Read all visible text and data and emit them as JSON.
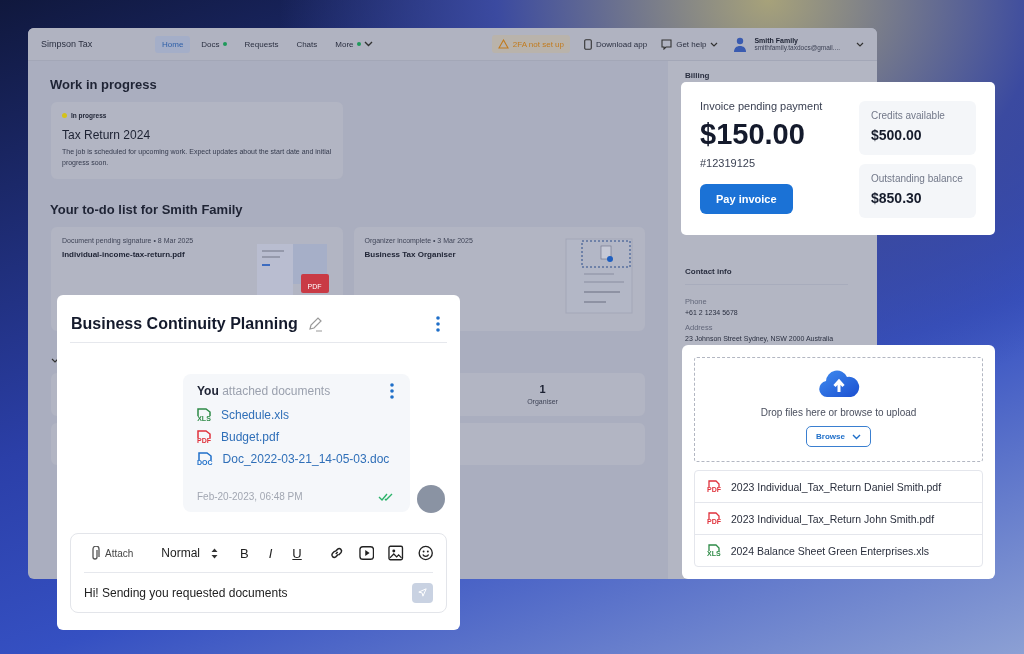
{
  "app": {
    "brand": "Simpson Tax",
    "nav": [
      {
        "label": "Home",
        "selected": true,
        "dot": false,
        "dropdown": false
      },
      {
        "label": "Docs",
        "selected": false,
        "dot": true,
        "dropdown": false
      },
      {
        "label": "Requests",
        "selected": false,
        "dot": false,
        "dropdown": false
      },
      {
        "label": "Chats",
        "selected": false,
        "dot": false,
        "dropdown": false
      },
      {
        "label": "More",
        "selected": false,
        "dot": true,
        "dropdown": true
      }
    ],
    "warning": "2FA not set up",
    "download": "Download app",
    "help": "Get help",
    "user": {
      "name": "Smith Family",
      "email": "smithfamily.taxdocs@gmail...."
    },
    "work_title": "Work in progress",
    "job": {
      "status": "In progress",
      "title": "Tax Return 2024",
      "description": "The job is scheduled for upcoming work. Expect updates about the start date and initial progress soon."
    },
    "todo_title": "Your to-do list for Smith Family",
    "todos": [
      {
        "kind": "pdf",
        "meta": "Document pending signature • 8 Mar 2025",
        "title": "Individual-income-tax-return.pdf",
        "badge": "PDF"
      },
      {
        "kind": "organiser",
        "meta": "Organizer incomplete • 3 Mar 2025",
        "title": "Business Tax Organiser"
      }
    ],
    "stats": [
      {
        "value": "1",
        "label": "Organiser"
      }
    ],
    "sidebar": {
      "billing": "Billing",
      "contact": "Contact info",
      "fields": [
        {
          "label": "Phone",
          "value": "+61 2 1234 5678"
        },
        {
          "label": "Address",
          "value": "23 Johnson Street Sydney, NSW 2000 Australia"
        }
      ]
    }
  },
  "invoice": {
    "label": "Invoice pending payment",
    "amount": "$150.00",
    "number": "#12319125",
    "button": "Pay invoice",
    "boxes": [
      {
        "label": "Credits available",
        "value": "$500.00"
      },
      {
        "label": "Outstanding balance",
        "value": "$850.30"
      }
    ]
  },
  "chat": {
    "title": "Business Continuity Planning",
    "message": {
      "author": "You",
      "action": "attached documents",
      "time": "Feb-20-2023, 06:48 PM",
      "read": true,
      "files": [
        {
          "kind": "xls",
          "badge": "XLS",
          "name": "Schedule.xls"
        },
        {
          "kind": "pdf",
          "badge": "PDF",
          "name": "Budget.pdf"
        },
        {
          "kind": "doc",
          "badge": "DOC",
          "name": "Doc_2022-03-21_14-05-03.doc"
        }
      ]
    },
    "toolbar": {
      "attach": "Attach",
      "style": "Normal",
      "bold": "B",
      "italic": "I",
      "underline": "U"
    },
    "draft": "Hi! Sending you requested documents"
  },
  "upload": {
    "prompt": "Drop files here or browse to upload",
    "button": "Browse",
    "files": [
      {
        "kind": "pdf",
        "badge": "PDF",
        "name": "2023 Individual_Tax_Return Daniel Smith.pdf"
      },
      {
        "kind": "pdf",
        "badge": "PDF",
        "name": "2023 Individual_Tax_Return John Smith.pdf"
      },
      {
        "kind": "xls",
        "badge": "XLS",
        "name": "2024 Balance Sheet Green Enterprises.xls"
      }
    ]
  }
}
